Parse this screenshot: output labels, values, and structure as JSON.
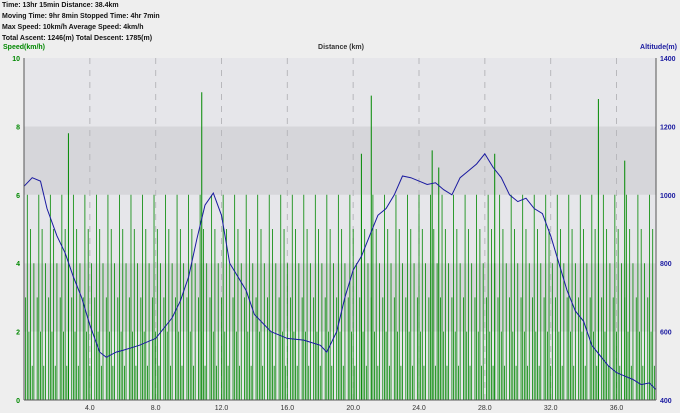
{
  "stats": {
    "line1": "Time: 13hr 15min  Distance: 38.4km",
    "line2": "Moving Time: 9hr 8min  Stopped Time: 4hr 7min",
    "line3": "Max Speed: 10km/h  Average Speed: 4km/h",
    "line4": "Total Ascent: 1246(m)  Total Descent: 1785(m)"
  },
  "colors": {
    "speed": "#008800",
    "altitude": "#1a1aa0",
    "band_dark": "#d6d6da",
    "band_light": "#e6e6ea",
    "background": "#eeeeee"
  },
  "chart_data": {
    "type": "line",
    "xlabel": "Distance (km)",
    "y_left_label": "Speed(km/h)",
    "y_right_label": "Altitude(m)",
    "x_range": [
      0,
      38.4
    ],
    "x_ticks": [
      4.0,
      8.0,
      12.0,
      16.0,
      20.0,
      24.0,
      28.0,
      32.0,
      36.0
    ],
    "x_tick_labels": [
      "4.0",
      "8.0",
      "12.0",
      "16.0",
      "20.0",
      "24.0",
      "28.0",
      "32.0",
      "36.0"
    ],
    "y_left_range": [
      0,
      10
    ],
    "y_left_ticks": [
      0,
      2,
      4,
      6,
      8,
      10
    ],
    "y_right_range": [
      400,
      1400
    ],
    "y_right_ticks": [
      400,
      600,
      800,
      1000,
      1200,
      1400
    ],
    "legend": "top-left and top-right axis titles",
    "series": [
      {
        "name": "Altitude(m)",
        "axis": "right",
        "x": [
          0,
          0.5,
          1.0,
          1.4,
          2.0,
          2.5,
          3.0,
          3.5,
          4.0,
          4.6,
          5.0,
          5.6,
          6.0,
          7.0,
          8.0,
          9.0,
          9.5,
          10.0,
          10.5,
          11.0,
          11.5,
          12.0,
          12.5,
          13.0,
          13.5,
          14.0,
          15.0,
          16.0,
          17.0,
          18.0,
          18.4,
          19.0,
          19.5,
          20.0,
          20.5,
          21.0,
          21.5,
          22.0,
          22.5,
          23.0,
          23.5,
          24.0,
          24.5,
          25.0,
          25.5,
          26.0,
          26.5,
          27.0,
          27.5,
          28.0,
          28.5,
          29.0,
          29.5,
          30.0,
          30.5,
          31.0,
          31.5,
          32.0,
          32.5,
          33.0,
          33.5,
          34.0,
          34.5,
          35.0,
          35.5,
          36.0,
          36.5,
          37.0,
          37.5,
          38.0,
          38.4
        ],
        "y": [
          1025,
          1050,
          1040,
          960,
          880,
          830,
          760,
          700,
          620,
          540,
          525,
          540,
          545,
          560,
          580,
          640,
          690,
          760,
          870,
          970,
          1005,
          940,
          800,
          760,
          720,
          650,
          600,
          580,
          575,
          560,
          540,
          600,
          700,
          780,
          820,
          880,
          940,
          960,
          1000,
          1055,
          1050,
          1040,
          1030,
          1035,
          1015,
          1000,
          1050,
          1070,
          1090,
          1120,
          1080,
          1050,
          1000,
          980,
          990,
          960,
          945,
          880,
          800,
          720,
          660,
          630,
          560,
          530,
          500,
          480,
          470,
          460,
          445,
          450,
          430
        ]
      },
      {
        "name": "Speed(km/h)",
        "axis": "left",
        "x_step": 0.1,
        "levels_cycle": [
          0,
          1,
          2,
          3,
          4,
          5,
          6
        ],
        "spikes": [
          {
            "x": 10.8,
            "y": 9.0
          },
          {
            "x": 2.7,
            "y": 7.8
          },
          {
            "x": 21.1,
            "y": 8.9
          },
          {
            "x": 34.9,
            "y": 8.8
          },
          {
            "x": 20.5,
            "y": 7.2
          },
          {
            "x": 28.6,
            "y": 7.2
          },
          {
            "x": 24.8,
            "y": 7.3
          },
          {
            "x": 36.5,
            "y": 7.0
          },
          {
            "x": 25.2,
            "y": 6.8
          }
        ]
      }
    ]
  }
}
